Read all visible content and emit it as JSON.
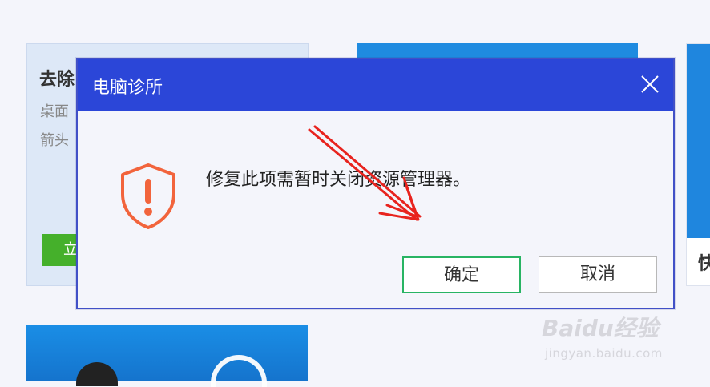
{
  "background_cards": {
    "left": {
      "title_fragment": "去除",
      "desc_line1": "桌面",
      "desc_line2": "箭头",
      "button_fragment": "立"
    },
    "right": {
      "title_fragment": "快"
    }
  },
  "dialog": {
    "title": "电脑诊所",
    "message": "修复此项需暂时关闭资源管理器。",
    "ok_label": "确定",
    "cancel_label": "取消",
    "header_color": "#2b46d8",
    "icon": "warning-shield-icon"
  },
  "watermark": {
    "logo": "Baidu经验",
    "url": "jingyan.baidu.com"
  },
  "annotation": {
    "type": "red-arrow"
  }
}
